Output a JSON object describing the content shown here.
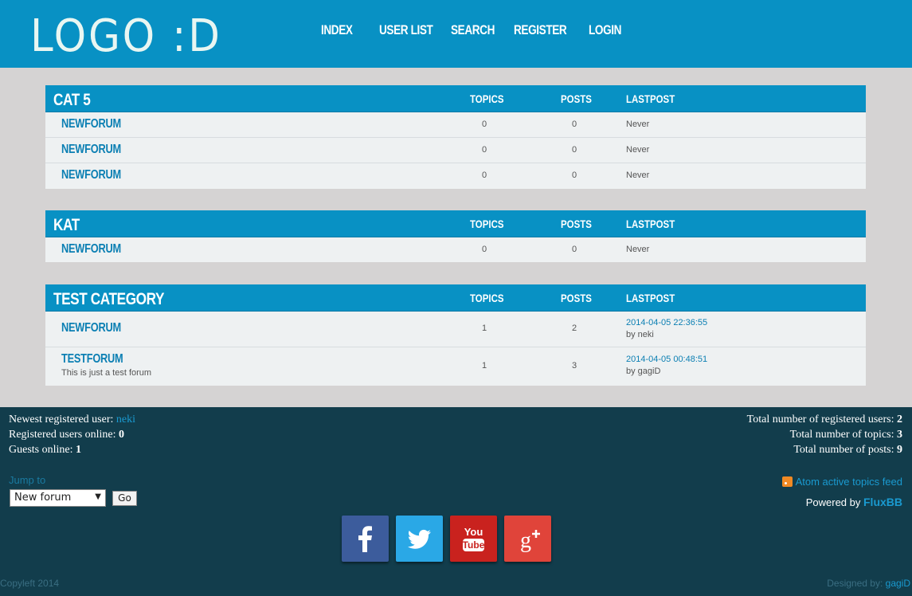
{
  "header": {
    "logo": "LOGO :D",
    "nav": [
      "INDEX",
      "USER LIST",
      "SEARCH",
      "REGISTER",
      "LOGIN"
    ]
  },
  "columns": {
    "topics": "TOPICS",
    "posts": "POSTS",
    "lastpost": "LASTPOST"
  },
  "categories": [
    {
      "title": "CAT 5",
      "forums": [
        {
          "name": "NEWFORUM",
          "topics": "0",
          "posts": "0",
          "last": "Never"
        },
        {
          "name": "NEWFORUM",
          "topics": "0",
          "posts": "0",
          "last": "Never"
        },
        {
          "name": "NEWFORUM",
          "topics": "0",
          "posts": "0",
          "last": "Never"
        }
      ]
    },
    {
      "title": "KAT",
      "forums": [
        {
          "name": "NEWFORUM",
          "topics": "0",
          "posts": "0",
          "last": "Never"
        }
      ]
    },
    {
      "title": "TEST CATEGORY",
      "forums": [
        {
          "name": "NEWFORUM",
          "topics": "1",
          "posts": "2",
          "last_date": "2014-04-05 22:36:55",
          "last_by": "by neki"
        },
        {
          "name": "TESTFORUM",
          "desc": "This is just a test forum",
          "topics": "1",
          "posts": "3",
          "last_date": "2014-04-05 00:48:51",
          "last_by": "by gagiD"
        }
      ]
    }
  ],
  "footer": {
    "newest_label": "Newest registered user:",
    "newest_user": "neki",
    "online_label": "Registered users online:",
    "online_value": "0",
    "guests_label": "Guests online:",
    "guests_value": "1",
    "total_users_label": "Total number of registered users:",
    "total_users": "2",
    "total_topics_label": "Total number of topics:",
    "total_topics": "3",
    "total_posts_label": "Total number of posts:",
    "total_posts": "9",
    "jump_label": "Jump to",
    "jump_selected": "New forum",
    "go_label": "Go",
    "feed_label": "Atom active topics feed",
    "powered_label": "Powered by",
    "powered_link": "FluxBB",
    "copyleft": "Copyleft 2014",
    "designed_label": "Designed by:",
    "designed_link": "gagiD",
    "social": [
      "facebook-icon",
      "twitter-icon",
      "youtube-icon",
      "google-plus-icon"
    ]
  },
  "colors": {
    "header_bg": "#0891c4",
    "body_bg": "#d5d3d3",
    "footer_bg": "#123d4c",
    "link": "#0b7fb3"
  }
}
